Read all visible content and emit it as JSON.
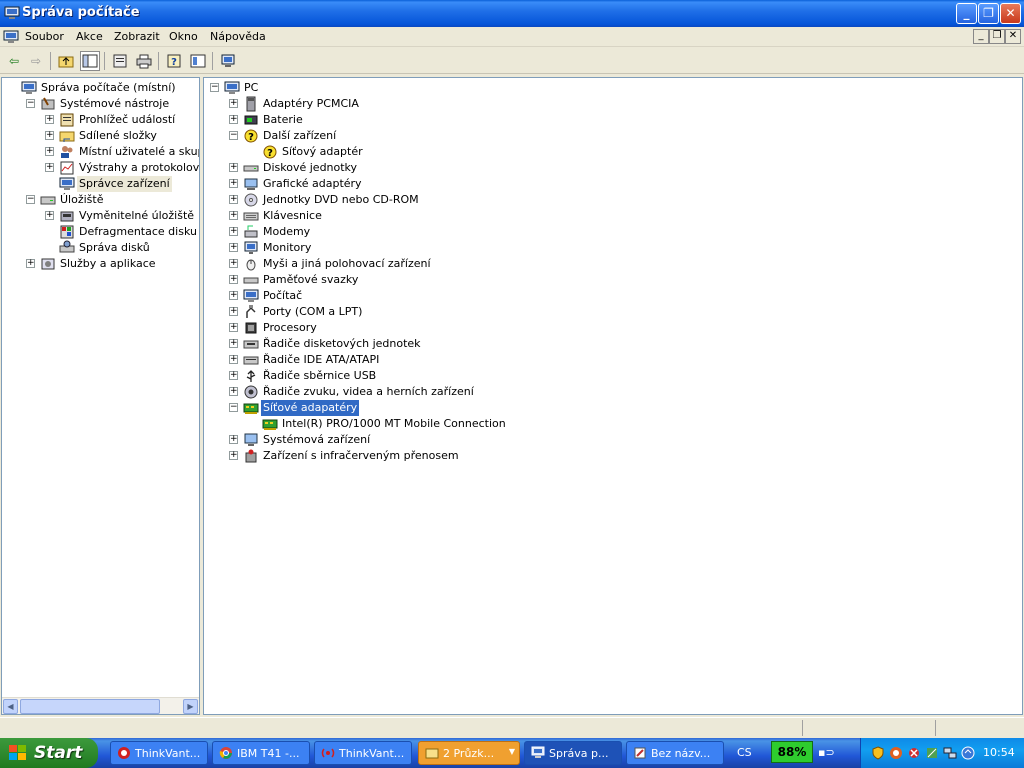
{
  "window": {
    "title": "Správa počítače"
  },
  "menu": {
    "items": [
      "Soubor",
      "Akce",
      "Zobrazit",
      "Okno",
      "Nápověda"
    ]
  },
  "left_tree": [
    {
      "label": "Správa počítače (místní)",
      "level": 0,
      "toggle": "",
      "icon": "computer-management-icon"
    },
    {
      "label": "Systémové nástroje",
      "level": 1,
      "toggle": "-",
      "icon": "system-tools-icon"
    },
    {
      "label": "Prohlížeč událostí",
      "level": 2,
      "toggle": "+",
      "icon": "event-viewer-icon"
    },
    {
      "label": "Sdílené složky",
      "level": 2,
      "toggle": "+",
      "icon": "shared-folders-icon"
    },
    {
      "label": "Místní uživatelé a skupiny",
      "level": 2,
      "toggle": "+",
      "icon": "users-groups-icon"
    },
    {
      "label": "Výstrahy a protokolování vý",
      "level": 2,
      "toggle": "+",
      "icon": "performance-logs-icon"
    },
    {
      "label": "Správce zařízení",
      "level": 2,
      "toggle": "",
      "icon": "device-manager-icon",
      "selected": true
    },
    {
      "label": "Úložiště",
      "level": 1,
      "toggle": "-",
      "icon": "storage-icon"
    },
    {
      "label": "Vyměnitelné úložiště",
      "level": 2,
      "toggle": "+",
      "icon": "removable-storage-icon"
    },
    {
      "label": "Defragmentace disku",
      "level": 2,
      "toggle": "",
      "icon": "defragmenter-icon"
    },
    {
      "label": "Správa disků",
      "level": 2,
      "toggle": "",
      "icon": "disk-management-icon"
    },
    {
      "label": "Služby a aplikace",
      "level": 1,
      "toggle": "+",
      "icon": "services-applications-icon"
    }
  ],
  "device_tree": [
    {
      "label": "PC",
      "level": 0,
      "toggle": "-",
      "icon": "computer-icon"
    },
    {
      "label": "Adaptéry PCMCIA",
      "level": 1,
      "toggle": "+",
      "icon": "pcmcia-icon"
    },
    {
      "label": "Baterie",
      "level": 1,
      "toggle": "+",
      "icon": "battery-icon"
    },
    {
      "label": "Další zařízení",
      "level": 1,
      "toggle": "-",
      "icon": "unknown-device-icon"
    },
    {
      "label": "Síťový adaptér",
      "level": 2,
      "toggle": "",
      "icon": "warning-device-icon"
    },
    {
      "label": "Diskové jednotky",
      "level": 1,
      "toggle": "+",
      "icon": "disk-drive-icon"
    },
    {
      "label": "Grafické adaptéry",
      "level": 1,
      "toggle": "+",
      "icon": "display-adapter-icon"
    },
    {
      "label": "Jednotky DVD nebo CD-ROM",
      "level": 1,
      "toggle": "+",
      "icon": "cdrom-icon"
    },
    {
      "label": "Klávesnice",
      "level": 1,
      "toggle": "+",
      "icon": "keyboard-icon"
    },
    {
      "label": "Modemy",
      "level": 1,
      "toggle": "+",
      "icon": "modem-icon"
    },
    {
      "label": "Monitory",
      "level": 1,
      "toggle": "+",
      "icon": "monitor-icon"
    },
    {
      "label": "Myši a jiná polohovací zařízení",
      "level": 1,
      "toggle": "+",
      "icon": "mouse-icon"
    },
    {
      "label": "Paměťové svazky",
      "level": 1,
      "toggle": "+",
      "icon": "storage-volume-icon"
    },
    {
      "label": "Počítač",
      "level": 1,
      "toggle": "+",
      "icon": "computer-icon"
    },
    {
      "label": "Porty (COM a LPT)",
      "level": 1,
      "toggle": "+",
      "icon": "port-icon"
    },
    {
      "label": "Procesory",
      "level": 1,
      "toggle": "+",
      "icon": "processor-icon"
    },
    {
      "label": "Řadiče disketových jednotek",
      "level": 1,
      "toggle": "+",
      "icon": "floppy-controller-icon"
    },
    {
      "label": "Řadiče IDE ATA/ATAPI",
      "level": 1,
      "toggle": "+",
      "icon": "ide-controller-icon"
    },
    {
      "label": "Řadiče sběrnice USB",
      "level": 1,
      "toggle": "+",
      "icon": "usb-icon"
    },
    {
      "label": "Řadiče zvuku, videa a herních zařízení",
      "level": 1,
      "toggle": "+",
      "icon": "sound-icon"
    },
    {
      "label": "Síťové adapatéry",
      "level": 1,
      "toggle": "-",
      "icon": "network-adapter-icon",
      "selected": true
    },
    {
      "label": "Intel(R) PRO/1000 MT Mobile Connection",
      "level": 2,
      "toggle": "",
      "icon": "network-card-icon"
    },
    {
      "label": "Systémová zařízení",
      "level": 1,
      "toggle": "+",
      "icon": "system-device-icon"
    },
    {
      "label": "Zařízení s infračerveným přenosem",
      "level": 1,
      "toggle": "+",
      "icon": "infrared-icon"
    }
  ],
  "taskbar": {
    "start": "Start",
    "tasks": [
      {
        "label": "ThinkVant...",
        "icon": "thinkvantage-icon"
      },
      {
        "label": "IBM T41 -...",
        "icon": "chrome-icon"
      },
      {
        "label": "ThinkVant...",
        "icon": "thinkvantage-wireless-icon"
      },
      {
        "label": "2 Průzk...",
        "icon": "folder-icon"
      },
      {
        "label": "Správa p...",
        "icon": "computer-management-icon"
      },
      {
        "label": "Bez názv...",
        "icon": "paint-icon"
      }
    ],
    "language": "CS",
    "battery": "88%",
    "clock": "10:54"
  }
}
